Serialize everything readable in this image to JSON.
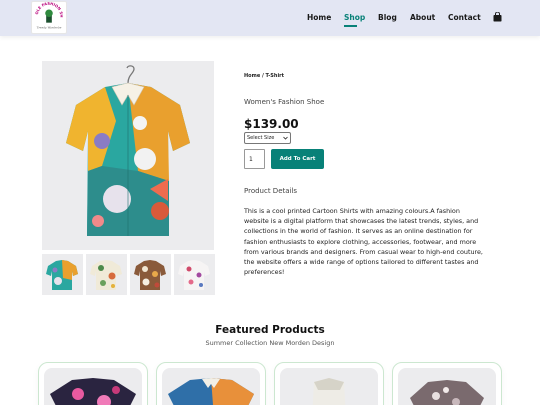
{
  "header": {
    "logo_text": "OLE FASHION SHOP",
    "logo_subtext": "Trendy Wardrobe",
    "nav": [
      {
        "label": "Home",
        "active": false
      },
      {
        "label": "Shop",
        "active": true
      },
      {
        "label": "Blog",
        "active": false
      },
      {
        "label": "About",
        "active": false
      },
      {
        "label": "Contact",
        "active": false
      }
    ],
    "cart_icon": "shopping-bag-icon"
  },
  "gallery": {
    "main_image": "printed-cartoon-shirt",
    "thumbnails": [
      "shirt-teal-floral",
      "shirt-cream-botanical",
      "shirt-brown-floral",
      "shirt-white-floral"
    ]
  },
  "product": {
    "breadcrumb": "Home / T-Shirt",
    "name": "Women's Fashion Shoe",
    "price": "$139.00",
    "size_select": "Select Size",
    "quantity": "1",
    "add_to_cart": "Add To Cart",
    "details_heading": "Product Details",
    "details_text": "This is a cool printed Cartoon Shirts with amazing colours.A fashion website is a digital platform that showcases the latest trends, styles, and collections in the world of fashion. It serves as an online destination for fashion enthusiasts to explore clothing, accessories, footwear, and more from various brands and designers. From casual wear to high-end couture, the website offers a wide range of options tailored to different tastes and preferences!"
  },
  "featured": {
    "title": "Featured Products",
    "subtitle": "Summer Collection New Morden Design"
  },
  "colors": {
    "accent": "#088178",
    "header_bg": "#e3e6f3",
    "image_bg": "#ececee"
  }
}
